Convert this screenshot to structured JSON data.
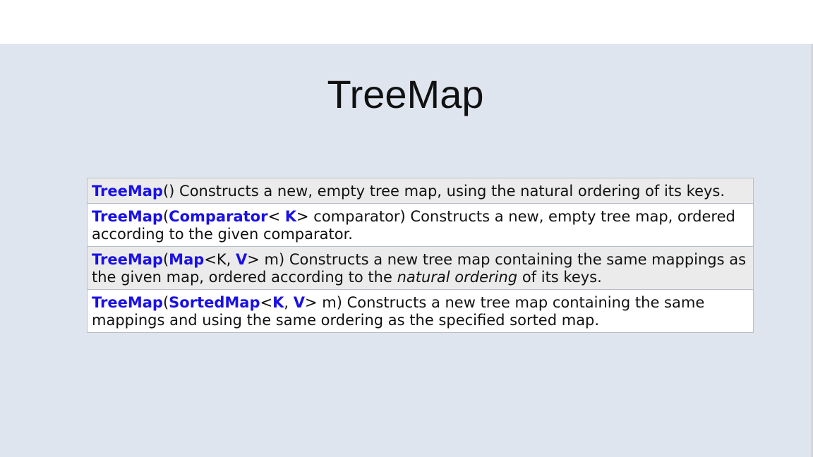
{
  "slide": {
    "title": "TreeMap"
  },
  "constructors": [
    {
      "name": "TreeMap",
      "signature_rest": "()",
      "description": " Constructs a new, empty tree map, using the natural ordering of its keys."
    },
    {
      "name": "TreeMap",
      "open_paren": "(",
      "param_type": "Comparator",
      "lt": "< ",
      "type_param": "K",
      "rest": "> comparator)",
      "description": " Constructs a new, empty tree map, ordered according to the given comparator."
    },
    {
      "name": "TreeMap",
      "open_paren": "(",
      "param_type": "Map",
      "generic_k": "<K, ",
      "type_param": "V",
      "rest": "> m)",
      "description_before_italic": " Constructs a new tree map containing the same mappings as the given map, ordered according to the ",
      "italic": "natural ordering",
      "description_after_italic": " of its keys."
    },
    {
      "name": "TreeMap",
      "open_paren": "(",
      "param_type": "SortedMap",
      "lt": "<",
      "type_param_k": "K",
      "comma": ", ",
      "type_param_v": "V",
      "rest": "> m)",
      "description": " Constructs a new tree map containing the same mappings and using the same ordering as the specified sorted map."
    }
  ],
  "colors": {
    "slide_background": "#dfe5ef",
    "link_blue": "#1a10e6",
    "row_shade": "#ebebeb",
    "row_plain": "#ffffff"
  }
}
